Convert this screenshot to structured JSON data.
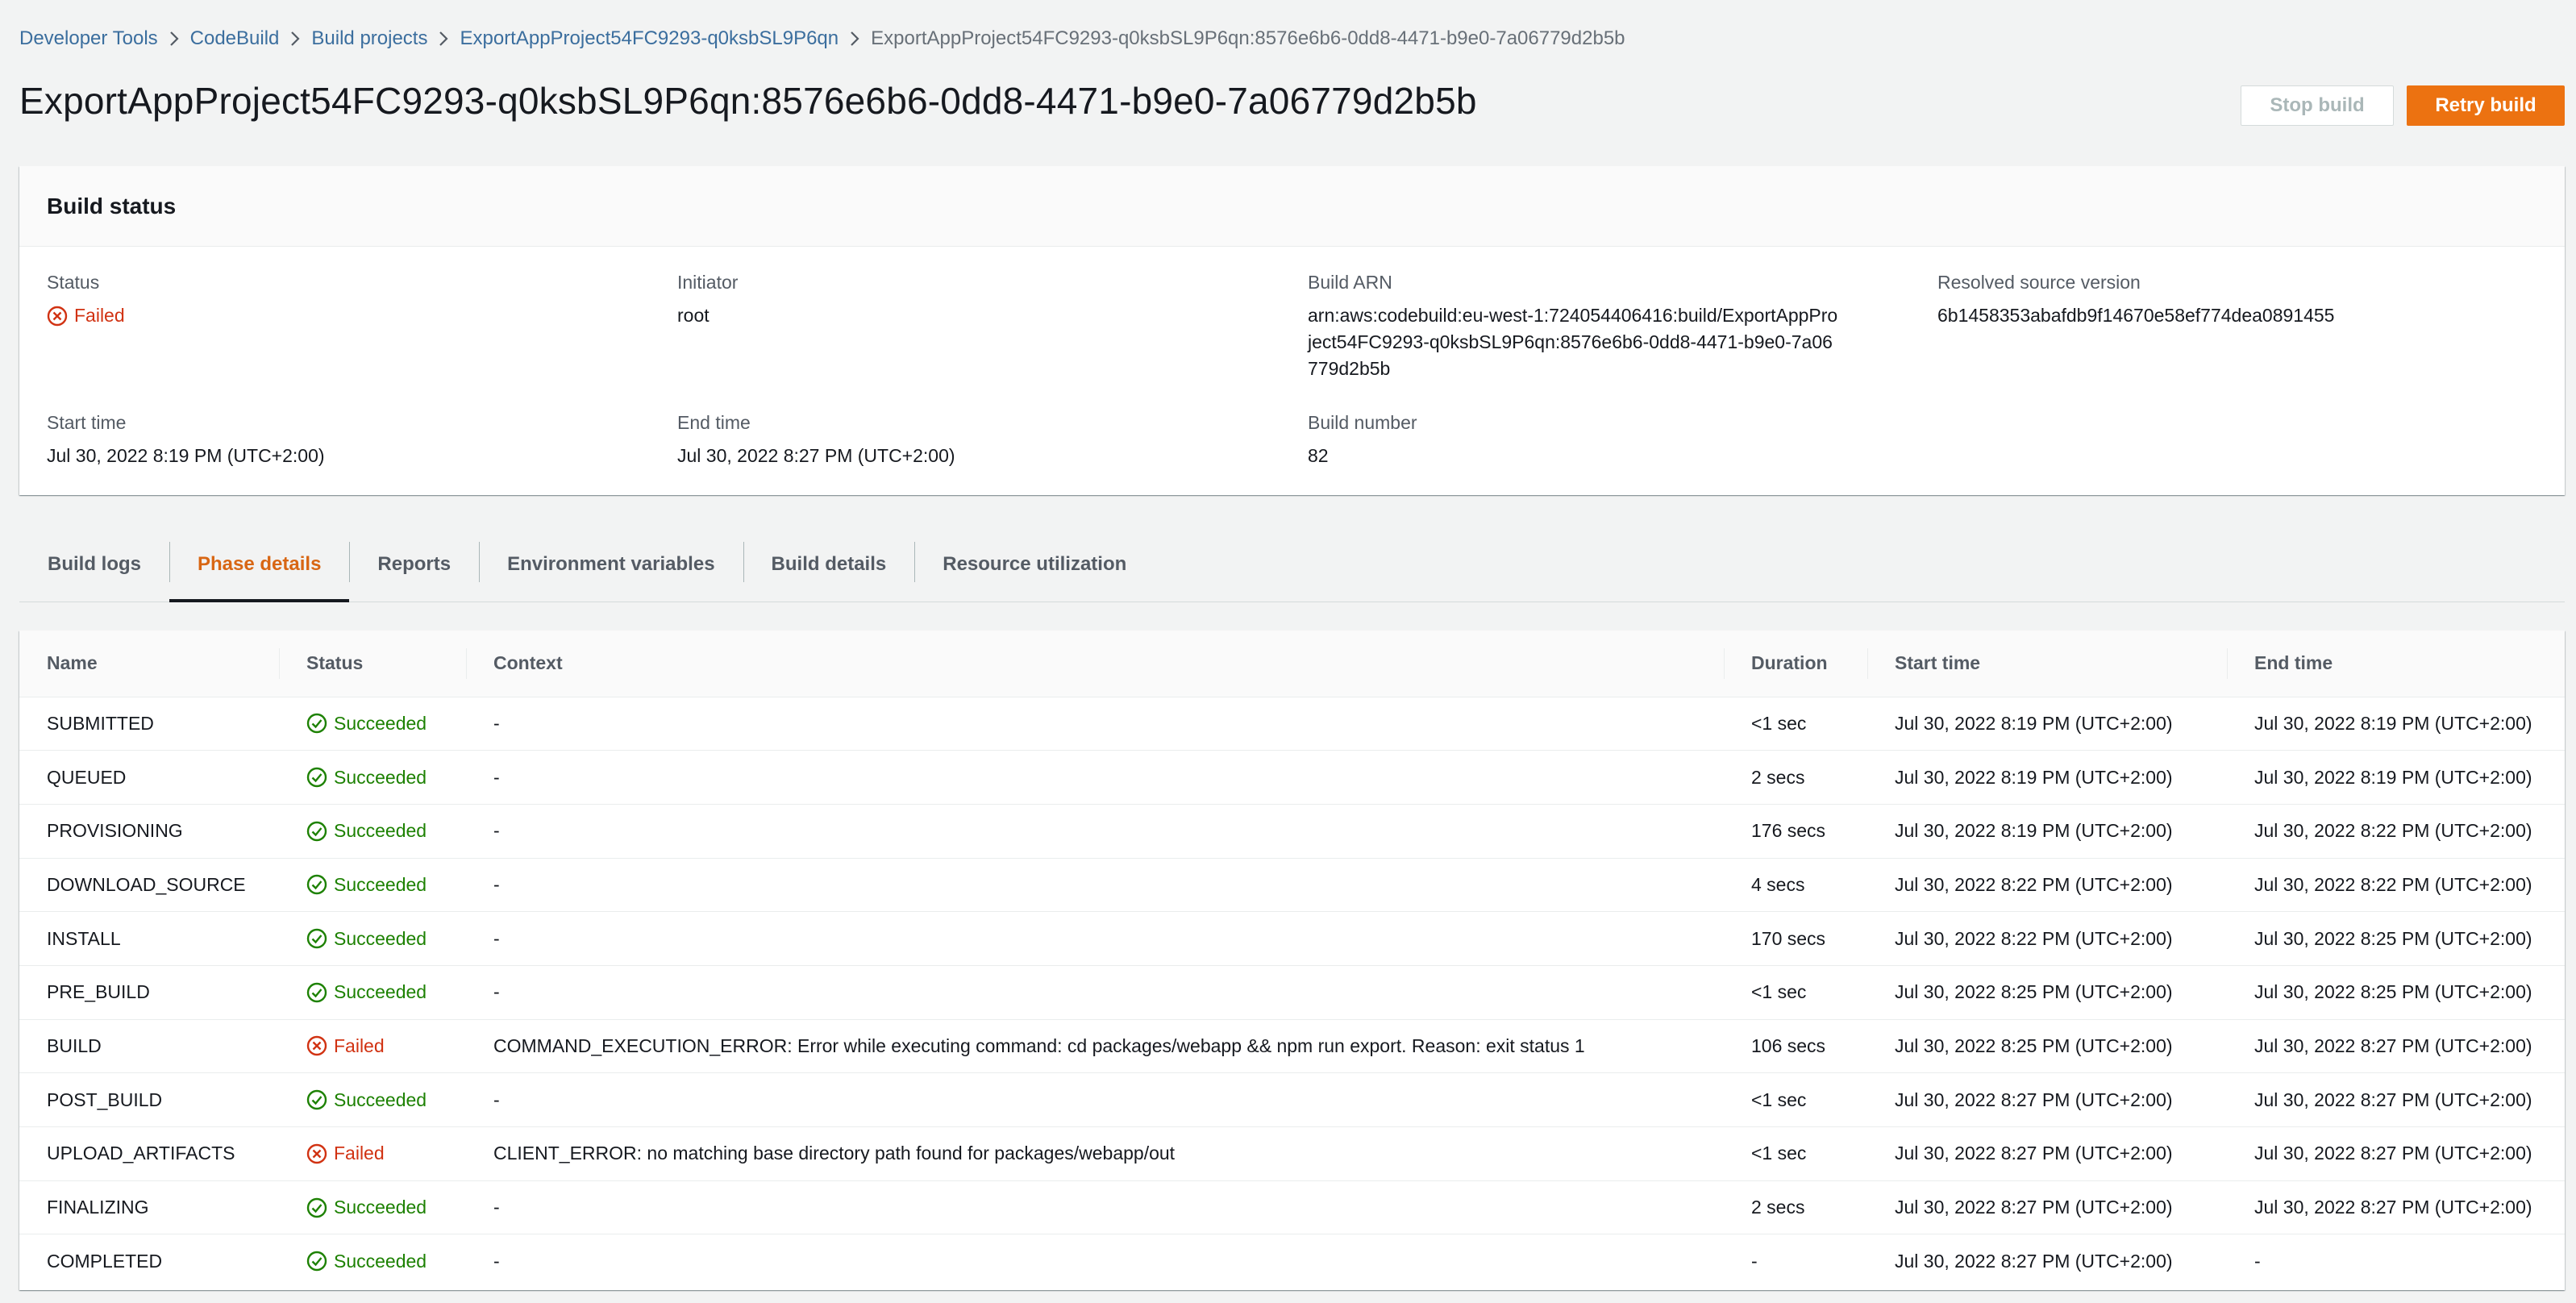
{
  "breadcrumb": {
    "items": [
      "Developer Tools",
      "CodeBuild",
      "Build projects",
      "ExportAppProject54FC9293-q0ksbSL9P6qn"
    ],
    "current": "ExportAppProject54FC9293-q0ksbSL9P6qn:8576e6b6-0dd8-4471-b9e0-7a06779d2b5b"
  },
  "page_title": "ExportAppProject54FC9293-q0ksbSL9P6qn:8576e6b6-0dd8-4471-b9e0-7a06779d2b5b",
  "actions": {
    "stop_build": "Stop build",
    "retry_build": "Retry build"
  },
  "build_status": {
    "heading": "Build status",
    "status_label": "Status",
    "status_value": "Failed",
    "initiator_label": "Initiator",
    "initiator_value": "root",
    "arn_label": "Build ARN",
    "arn_value": "arn:aws:codebuild:eu-west-1:724054406416:build/ExportAppProject54FC9293-q0ksbSL9P6qn:8576e6b6-0dd8-4471-b9e0-7a06779d2b5b",
    "source_label": "Resolved source version",
    "source_value": "6b1458353abafdb9f14670e58ef774dea0891455",
    "start_label": "Start time",
    "start_value": "Jul 30, 2022 8:19 PM (UTC+2:00)",
    "end_label": "End time",
    "end_value": "Jul 30, 2022 8:27 PM (UTC+2:00)",
    "number_label": "Build number",
    "number_value": "82"
  },
  "tabs": [
    {
      "label": "Build logs",
      "active": false
    },
    {
      "label": "Phase details",
      "active": true
    },
    {
      "label": "Reports",
      "active": false
    },
    {
      "label": "Environment variables",
      "active": false
    },
    {
      "label": "Build details",
      "active": false
    },
    {
      "label": "Resource utilization",
      "active": false
    }
  ],
  "phase_table": {
    "columns": [
      "Name",
      "Status",
      "Context",
      "Duration",
      "Start time",
      "End time"
    ],
    "rows": [
      {
        "name": "SUBMITTED",
        "status": "Succeeded",
        "context": "-",
        "duration": "<1 sec",
        "start": "Jul 30, 2022 8:19 PM (UTC+2:00)",
        "end": "Jul 30, 2022 8:19 PM (UTC+2:00)"
      },
      {
        "name": "QUEUED",
        "status": "Succeeded",
        "context": "-",
        "duration": "2 secs",
        "start": "Jul 30, 2022 8:19 PM (UTC+2:00)",
        "end": "Jul 30, 2022 8:19 PM (UTC+2:00)"
      },
      {
        "name": "PROVISIONING",
        "status": "Succeeded",
        "context": "-",
        "duration": "176 secs",
        "start": "Jul 30, 2022 8:19 PM (UTC+2:00)",
        "end": "Jul 30, 2022 8:22 PM (UTC+2:00)"
      },
      {
        "name": "DOWNLOAD_SOURCE",
        "status": "Succeeded",
        "context": "-",
        "duration": "4 secs",
        "start": "Jul 30, 2022 8:22 PM (UTC+2:00)",
        "end": "Jul 30, 2022 8:22 PM (UTC+2:00)"
      },
      {
        "name": "INSTALL",
        "status": "Succeeded",
        "context": "-",
        "duration": "170 secs",
        "start": "Jul 30, 2022 8:22 PM (UTC+2:00)",
        "end": "Jul 30, 2022 8:25 PM (UTC+2:00)"
      },
      {
        "name": "PRE_BUILD",
        "status": "Succeeded",
        "context": "-",
        "duration": "<1 sec",
        "start": "Jul 30, 2022 8:25 PM (UTC+2:00)",
        "end": "Jul 30, 2022 8:25 PM (UTC+2:00)"
      },
      {
        "name": "BUILD",
        "status": "Failed",
        "context": "COMMAND_EXECUTION_ERROR: Error while executing command: cd packages/webapp && npm run export. Reason: exit status 1",
        "duration": "106 secs",
        "start": "Jul 30, 2022 8:25 PM (UTC+2:00)",
        "end": "Jul 30, 2022 8:27 PM (UTC+2:00)"
      },
      {
        "name": "POST_BUILD",
        "status": "Succeeded",
        "context": "-",
        "duration": "<1 sec",
        "start": "Jul 30, 2022 8:27 PM (UTC+2:00)",
        "end": "Jul 30, 2022 8:27 PM (UTC+2:00)"
      },
      {
        "name": "UPLOAD_ARTIFACTS",
        "status": "Failed",
        "context": "CLIENT_ERROR: no matching base directory path found for packages/webapp/out",
        "duration": "<1 sec",
        "start": "Jul 30, 2022 8:27 PM (UTC+2:00)",
        "end": "Jul 30, 2022 8:27 PM (UTC+2:00)"
      },
      {
        "name": "FINALIZING",
        "status": "Succeeded",
        "context": "-",
        "duration": "2 secs",
        "start": "Jul 30, 2022 8:27 PM (UTC+2:00)",
        "end": "Jul 30, 2022 8:27 PM (UTC+2:00)"
      },
      {
        "name": "COMPLETED",
        "status": "Succeeded",
        "context": "-",
        "duration": "-",
        "start": "Jul 30, 2022 8:27 PM (UTC+2:00)",
        "end": "-"
      }
    ]
  },
  "icons": {
    "breadcrumb_separator": "chevron-right-icon",
    "failed": "status-error-icon",
    "succeeded": "status-success-icon"
  },
  "colors": {
    "primary_button": "#ec7211",
    "active_tab": "#d86613",
    "failed": "#d13212",
    "succeeded": "#1d8102",
    "link": "#3b6e9e"
  }
}
